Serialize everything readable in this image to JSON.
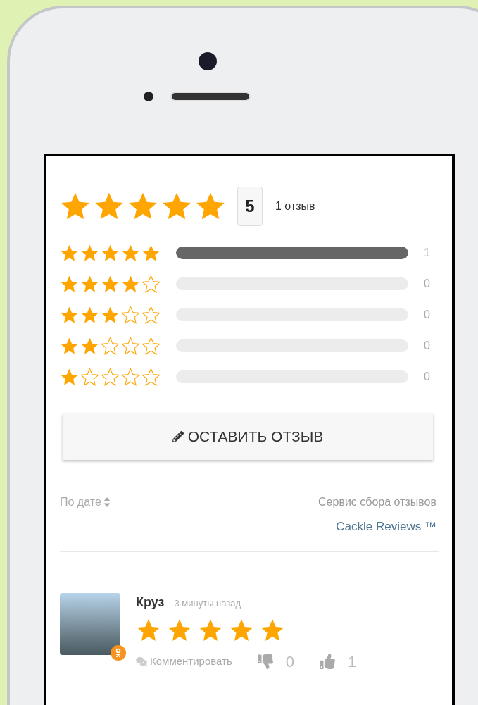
{
  "summary": {
    "stars": 5,
    "score": "5",
    "count_text": "1 отзыв"
  },
  "distribution": [
    {
      "stars": 5,
      "level": 1,
      "count": "1"
    },
    {
      "stars": 4,
      "level": 0,
      "count": "0"
    },
    {
      "stars": 3,
      "level": 0,
      "count": "0"
    },
    {
      "stars": 2,
      "level": 0,
      "count": "0"
    },
    {
      "stars": 1,
      "level": 0,
      "count": "0"
    }
  ],
  "write_button": "ОСТАВИТЬ ОТЗЫВ",
  "sort": "По дате",
  "service_label": "Сервис сбора отзывов",
  "service_link": "Cackle Reviews ™",
  "reviews": [
    {
      "author": "Круз",
      "time": "3 минуты назад",
      "stars": 5,
      "comment_link": "Комментировать",
      "dislikes": "0",
      "likes": "1"
    }
  ]
}
